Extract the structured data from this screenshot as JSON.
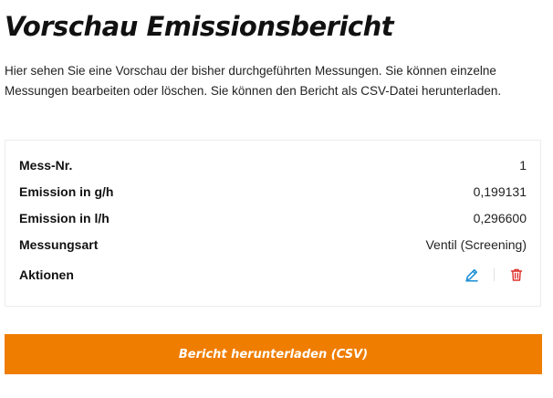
{
  "page": {
    "title": "Vorschau Emissionsbericht",
    "intro": "Hier sehen Sie eine Vorschau der bisher durchgeführten Messungen. Sie können einzelne Messungen bearbeiten oder löschen. Sie können den Bericht als CSV-Datei herunterladen."
  },
  "measurement": {
    "rows": [
      {
        "label": "Mess-Nr.",
        "value": "1"
      },
      {
        "label": "Emission in g/h",
        "value": "0,199131"
      },
      {
        "label": "Emission in l/h",
        "value": "0,296600"
      },
      {
        "label": "Messungsart",
        "value": "Ventil (Screening)"
      }
    ],
    "actions_label": "Aktionen",
    "actions": [
      {
        "icon": "edit-icon",
        "color": "#1a8fd6"
      },
      {
        "icon": "trash-icon",
        "color": "#e0312b"
      }
    ]
  },
  "download": {
    "label": "Bericht herunterladen (CSV)",
    "color": "#ef7d00"
  }
}
